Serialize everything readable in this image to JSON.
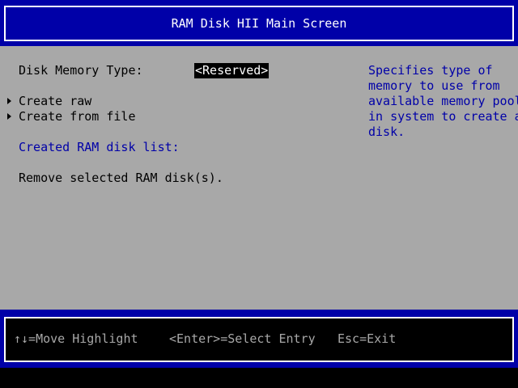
{
  "header": {
    "title": "RAM Disk HII Main Screen"
  },
  "form": {
    "disk_memory_type_label": "Disk Memory Type:",
    "disk_memory_type_value": "<Reserved>",
    "create_raw_label": "Create raw",
    "create_from_file_label": "Create from file",
    "created_list_label": "Created RAM disk list:",
    "remove_label": "Remove selected RAM disk(s)."
  },
  "help": {
    "lines": [
      "Specifies type of",
      "memory to use from",
      "available memory pool",
      "in system to create a",
      "disk."
    ]
  },
  "footer": {
    "move": "↑↓=Move Highlight",
    "select": "<Enter>=Select Entry",
    "exit": "Esc=Exit"
  },
  "colors": {
    "background": "#a8a8a8",
    "band": "#0000a8",
    "highlight_bg": "#000000",
    "highlight_fg": "#ffffff",
    "help_text": "#0000a8"
  }
}
